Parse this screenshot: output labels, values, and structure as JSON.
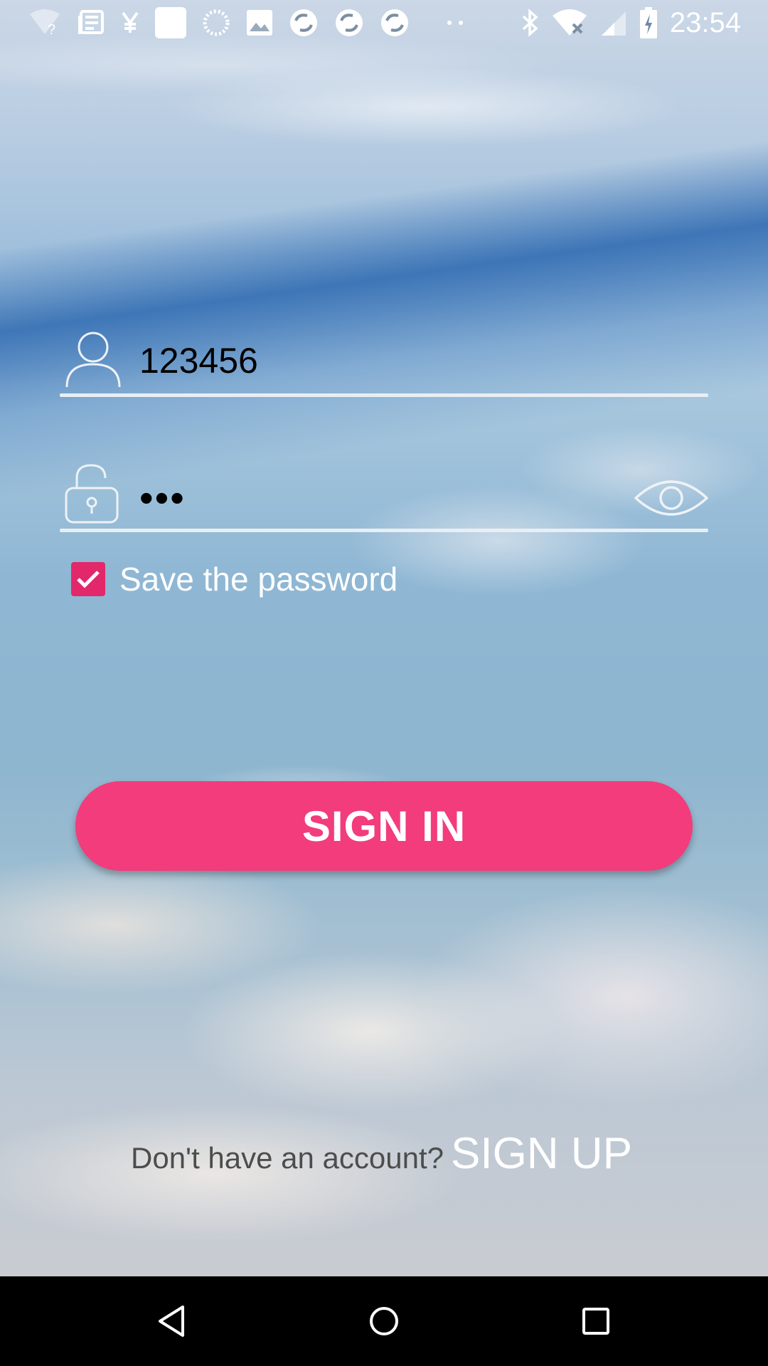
{
  "status_bar": {
    "time": "23:54",
    "left_icons": [
      "wifi-question-icon",
      "news-icon",
      "yen-icon",
      "white-square-icon",
      "loading-icon",
      "image-icon",
      "sync-icon",
      "sync-icon",
      "sync-icon",
      "more-dots-icon"
    ],
    "right_icons": [
      "bluetooth-icon",
      "wifi-off-icon",
      "signal-icon",
      "battery-charging-icon"
    ]
  },
  "login": {
    "username_value": "123456",
    "password_value": "•••",
    "save_password_label": "Save the password",
    "save_password_checked": true,
    "sign_in_label": "SIGN IN",
    "signup_prompt": "Don't have an account?",
    "signup_link": "SIGN UP"
  },
  "colors": {
    "accent": "#f23c7c",
    "checkbox": "#e2286a",
    "underline": "#e9eef3"
  },
  "nav_bar": {
    "buttons": [
      "back-icon",
      "home-icon",
      "recents-icon"
    ]
  }
}
